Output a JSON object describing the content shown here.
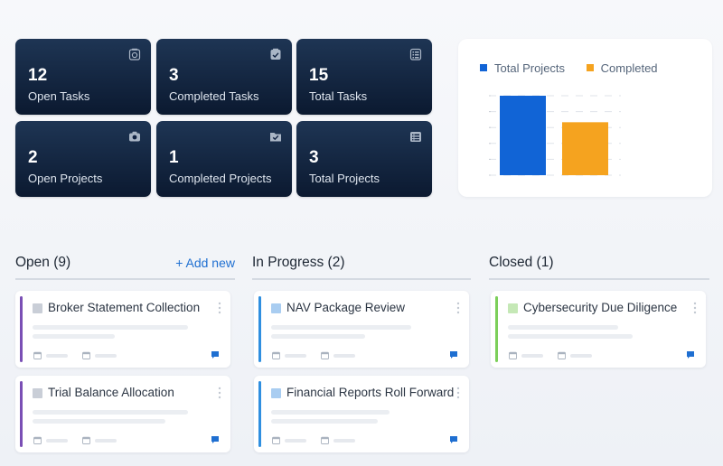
{
  "stats": [
    {
      "value": "12",
      "label": "Open Tasks"
    },
    {
      "value": "3",
      "label": "Completed Tasks"
    },
    {
      "value": "15",
      "label": "Total Tasks"
    },
    {
      "value": "2",
      "label": "Open Projects"
    },
    {
      "value": "1",
      "label": "Completed Projects"
    },
    {
      "value": "3",
      "label": "Total Projects"
    }
  ],
  "chart_data": {
    "type": "bar",
    "categories": [
      "Total Projects",
      "Completed"
    ],
    "series": [
      {
        "name": "Total Projects",
        "values": [
          3
        ],
        "color": "#1164d6"
      },
      {
        "name": "Completed",
        "values": [
          2
        ],
        "color": "#f5a31f"
      }
    ],
    "legend_placement": "top",
    "grid": true
  },
  "columns": {
    "open": {
      "title": "Open (9)",
      "add_label": "+ Add new"
    },
    "progress": {
      "title": "In Progress (2)"
    },
    "closed": {
      "title": "Closed (1)"
    }
  },
  "cards": {
    "broker": {
      "title": "Broker Statement Collection"
    },
    "trial": {
      "title": "Trial Balance Allocation"
    },
    "nav": {
      "title": "NAV Package Review"
    },
    "financial": {
      "title": "Financial Reports Roll Forward"
    },
    "cyber": {
      "title": "Cybersecurity Due Diligence"
    }
  },
  "colors": {
    "open_accent": "#7a4fb5",
    "progress_accent": "#2f8fe0",
    "closed_accent": "#7ccf5a",
    "link": "#1f6fd1",
    "tile_bg": "#0f2140"
  },
  "icons": {
    "stat_icons": [
      "clock-icon",
      "checklist-icon",
      "list-icon",
      "camera-icon",
      "folder-check-icon",
      "list-icon"
    ],
    "card_icons": [
      "calendar-icon",
      "comment-icon",
      "more-icon"
    ]
  }
}
